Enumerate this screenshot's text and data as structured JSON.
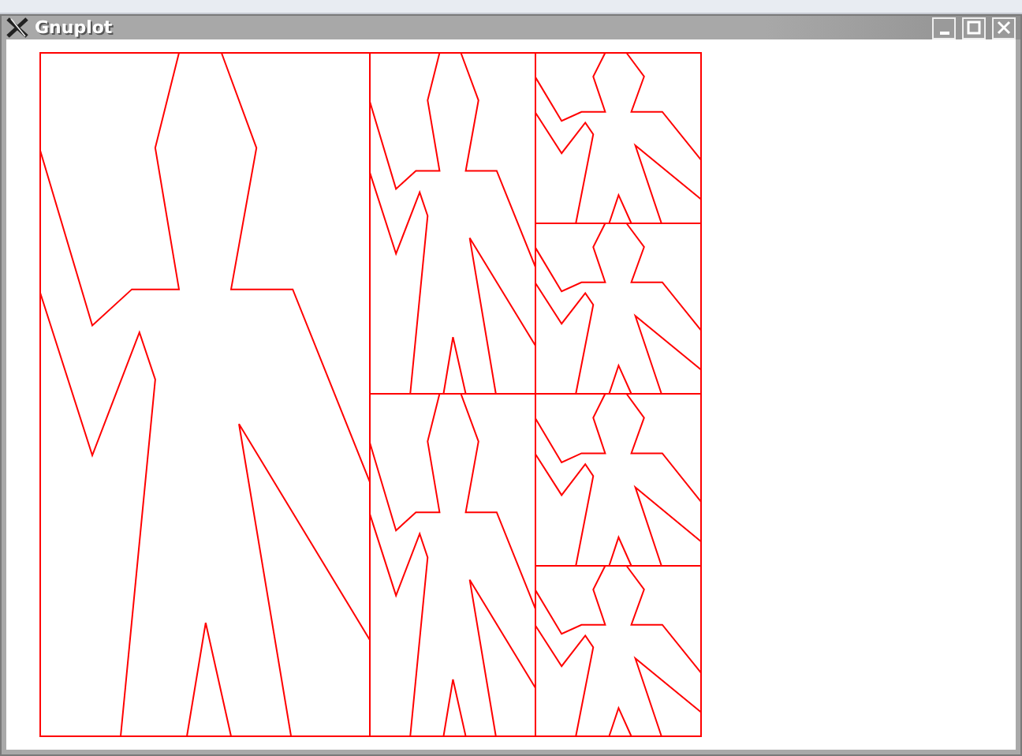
{
  "window": {
    "title": "Gnuplot"
  }
}
